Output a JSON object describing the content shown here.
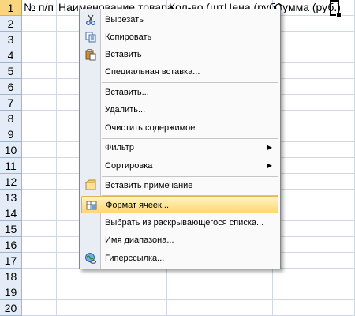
{
  "sheet": {
    "rows": [
      "1",
      "2",
      "3",
      "4",
      "5",
      "6",
      "7",
      "8",
      "9",
      "10",
      "11",
      "12",
      "13",
      "14",
      "15",
      "16",
      "17",
      "18",
      "19",
      "20"
    ],
    "headers": [
      "№ п/п",
      "Наименование товара",
      "Кол-во (шт",
      "Цена (руб.)",
      "Сумма (руб.)"
    ]
  },
  "menu": {
    "cut": "Вырезать",
    "copy": "Копировать",
    "paste": "Вставить",
    "paste_special": "Специальная вставка...",
    "insert": "Вставить...",
    "delete": "Удалить...",
    "clear": "Очистить содержимое",
    "filter": "Фильтр",
    "sort": "Сортировка",
    "insert_comment": "Вставить примечание",
    "format_cells": "Формат ячеек...",
    "pick_list": "Выбрать из раскрывающегося списка...",
    "range_name": "Имя диапазона...",
    "hyperlink": "Гиперссылка..."
  }
}
